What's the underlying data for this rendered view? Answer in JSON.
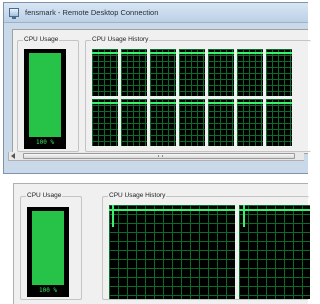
{
  "window": {
    "title": "fensmark - Remote Desktop Connection"
  },
  "remote": {
    "cpu_usage_label": "CPU Usage",
    "cpu_usage_value": "100 %",
    "cpu_history_label": "CPU Usage History"
  },
  "local": {
    "cpu_usage_label": "CPU Usage",
    "cpu_usage_value": "100 %",
    "cpu_history_label": "CPU Usage History"
  },
  "icons": {
    "window": "remote-desktop-icon",
    "scroll": "scroll-left-arrow-icon"
  },
  "colors": {
    "graph_background": "#000000",
    "graph_line": "#3bf06a",
    "meter_fill": "#27c348",
    "window_frame": "#c9d9ea"
  }
}
